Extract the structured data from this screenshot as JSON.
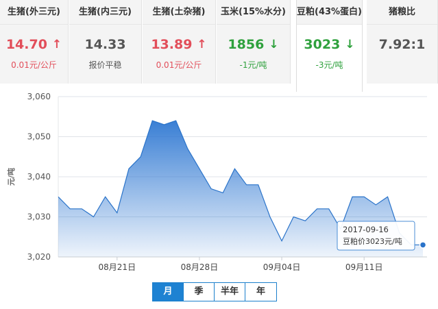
{
  "tabs": [
    {
      "title": "生猪(外三元)",
      "price": "14.70",
      "trend": "up",
      "change": "0.01元/公斤"
    },
    {
      "title": "生猪(内三元)",
      "price": "14.33",
      "trend": "flat",
      "change": "报价平稳"
    },
    {
      "title": "生猪(土杂猪)",
      "price": "13.89",
      "trend": "up",
      "change": "0.01元/公斤"
    },
    {
      "title": "玉米(15%水分)",
      "price": "1856",
      "trend": "down",
      "change": "-1元/吨"
    },
    {
      "title": "豆粕(43%蛋白)",
      "price": "3023",
      "trend": "down",
      "change": "-3元/吨",
      "active": true
    },
    {
      "title": "猪粮比",
      "price": "7.92:1",
      "trend": "flat",
      "change": ""
    }
  ],
  "icons": {
    "up": "arrow-up-icon",
    "down": "arrow-down-icon"
  },
  "colors": {
    "up": "#e24e5a",
    "down": "#2fa13d",
    "accent": "#1e82d2",
    "line": "#2a73c9"
  },
  "periods": [
    {
      "label": "月",
      "selected": true
    },
    {
      "label": "季",
      "selected": false
    },
    {
      "label": "半年",
      "selected": false
    },
    {
      "label": "年",
      "selected": false
    }
  ],
  "chart_data": {
    "type": "area",
    "ylabel": "元/吨",
    "ylim": [
      3020,
      3060
    ],
    "yticks": [
      3020,
      3030,
      3040,
      3050,
      3060
    ],
    "ytick_labels": [
      "3,020",
      "3,030",
      "3,040",
      "3,050",
      "3,060"
    ],
    "x": [
      "2017-08-16",
      "2017-08-17",
      "2017-08-18",
      "2017-08-19",
      "2017-08-20",
      "2017-08-21",
      "2017-08-22",
      "2017-08-23",
      "2017-08-24",
      "2017-08-25",
      "2017-08-26",
      "2017-08-27",
      "2017-08-28",
      "2017-08-29",
      "2017-08-30",
      "2017-08-31",
      "2017-09-01",
      "2017-09-02",
      "2017-09-03",
      "2017-09-04",
      "2017-09-05",
      "2017-09-06",
      "2017-09-07",
      "2017-09-08",
      "2017-09-09",
      "2017-09-10",
      "2017-09-11",
      "2017-09-12",
      "2017-09-13",
      "2017-09-14",
      "2017-09-15",
      "2017-09-16"
    ],
    "xticks": [
      {
        "date": "2017-08-21",
        "label": "08月21日"
      },
      {
        "date": "2017-08-28",
        "label": "08月28日"
      },
      {
        "date": "2017-09-04",
        "label": "09月04日"
      },
      {
        "date": "2017-09-11",
        "label": "09月11日"
      }
    ],
    "series": [
      {
        "values": [
          3035,
          3032,
          3032,
          3030,
          3035,
          3031,
          3042,
          3045,
          3054,
          3053,
          3054,
          3047,
          3042,
          3037,
          3036,
          3042,
          3038,
          3038,
          3030,
          3024,
          3030,
          3029,
          3032,
          3032,
          3027,
          3035,
          3035,
          3033,
          3035,
          3026,
          3023,
          3023
        ]
      }
    ],
    "tooltip": {
      "date": "2017-09-16",
      "text": "豆粕价3023元/吨"
    },
    "grid": true
  }
}
